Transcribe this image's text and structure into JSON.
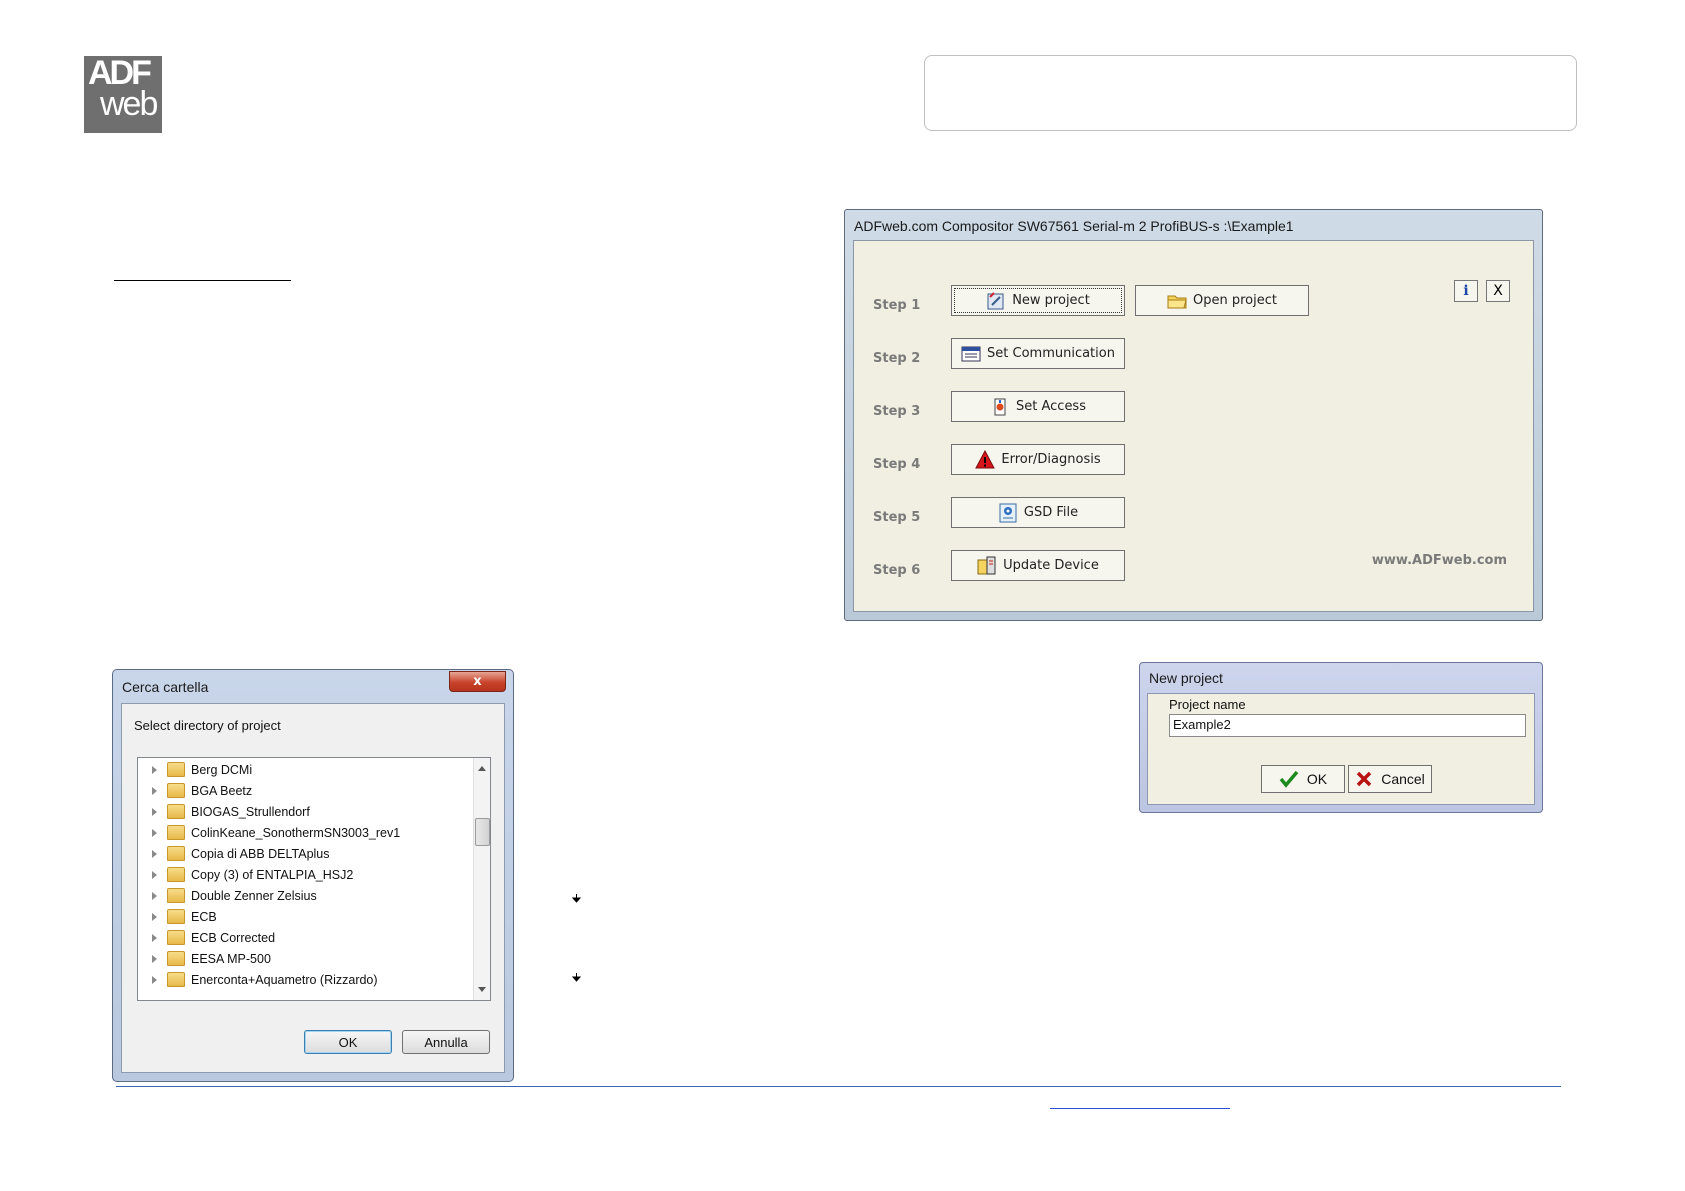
{
  "logo": {
    "line1": "ADF",
    "line2": "web"
  },
  "compositor": {
    "title": "ADFweb.com Compositor SW67561 Serial-m 2 ProfiBUS-s :\\Example1",
    "steps": [
      {
        "label": "Step 1",
        "button": "New project",
        "extra_button": "Open project"
      },
      {
        "label": "Step 2",
        "button": "Set Communication"
      },
      {
        "label": "Step 3",
        "button": "Set Access"
      },
      {
        "label": "Step 4",
        "button": "Error/Diagnosis"
      },
      {
        "label": "Step 5",
        "button": "GSD File"
      },
      {
        "label": "Step 6",
        "button": "Update Device"
      }
    ],
    "info_label": "i",
    "close_label": "X",
    "website": "www.ADFweb.com"
  },
  "cerca": {
    "title": "Cerca cartella",
    "close_label": "x",
    "prompt": "Select directory of project",
    "folders": [
      "Berg DCMi",
      "BGA Beetz",
      "BIOGAS_Strullendorf",
      "ColinKeane_SonothermSN3003_rev1",
      "Copia di ABB DELTAplus",
      "Copy (3) of ENTALPIA_HSJ2",
      "Double Zenner Zelsius",
      "ECB",
      "ECB Corrected",
      "EESA MP-500",
      "Enerconta+Aquametro (Rizzardo)"
    ],
    "ok_label": "OK",
    "cancel_label": "Annulla"
  },
  "new_project": {
    "title": "New project",
    "field_label": "Project name",
    "field_value": "Example2",
    "ok_label": "OK",
    "cancel_label": "Cancel"
  },
  "colors": {
    "footer_rule": "#3c64b5",
    "logo_bg": "#6f6f6f",
    "dialog_red": "#c9432b"
  }
}
